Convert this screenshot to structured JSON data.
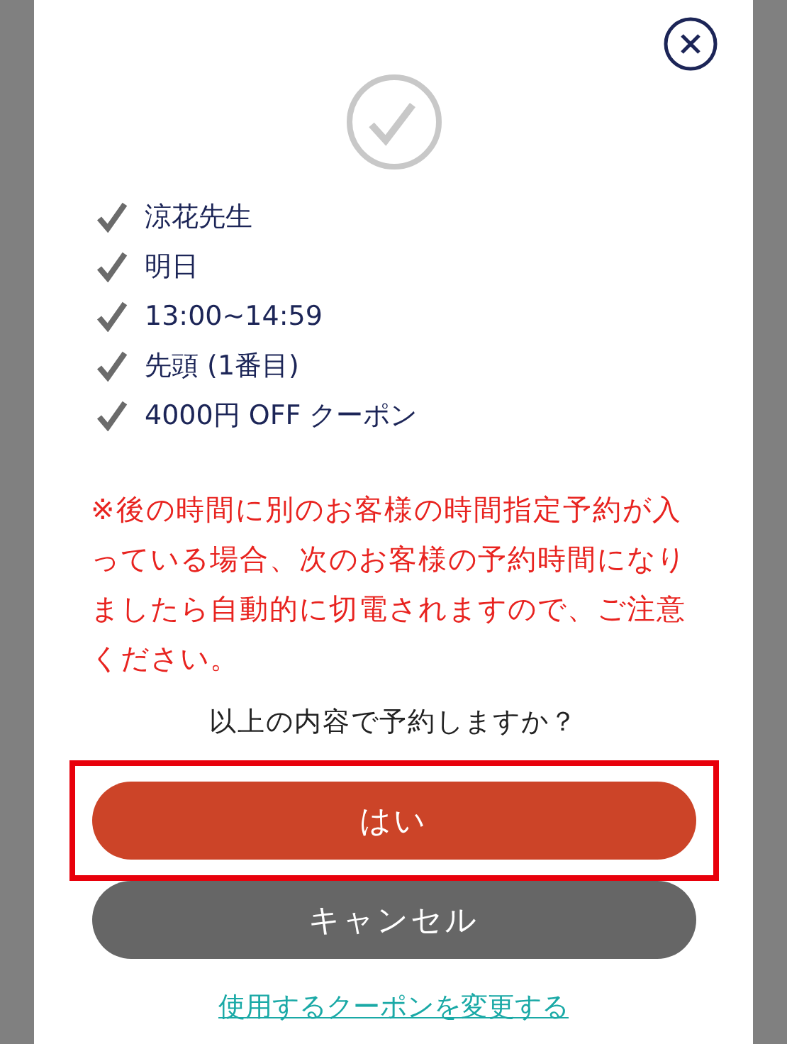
{
  "dialog": {
    "summary": [
      {
        "text": "涼花先生"
      },
      {
        "text": "明日"
      },
      {
        "text": "13:00~14:59"
      },
      {
        "text": "先頭 (1番目)"
      },
      {
        "text": "4000円 OFF クーポン"
      }
    ],
    "warning": "※後の時間に別のお客様の時間指定予約が入っている場合、次のお客様の予約時間になりましたら自動的に切電されますので、ご注意ください。",
    "question": "以上の内容で予約しますか？",
    "buttons": [
      {
        "label": "はい",
        "kind": "primary",
        "highlighted": true
      },
      {
        "label": "キャンセル",
        "kind": "secondary",
        "highlighted": false
      }
    ],
    "link": "使用するクーポンを変更する"
  }
}
